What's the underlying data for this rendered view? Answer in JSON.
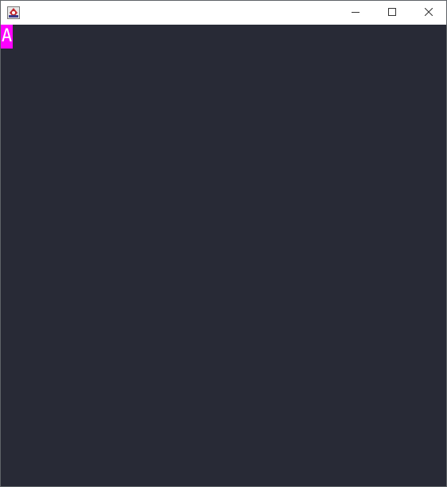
{
  "window": {
    "app_icon": "java-app-icon",
    "controls": {
      "minimize_icon": "minimize-icon",
      "maximize_icon": "maximize-icon",
      "close_icon": "close-icon"
    }
  },
  "canvas": {
    "background_color": "#282a36",
    "tile": {
      "character": "A",
      "background_color": "#ff00ff",
      "text_color": "#ffffff"
    }
  }
}
